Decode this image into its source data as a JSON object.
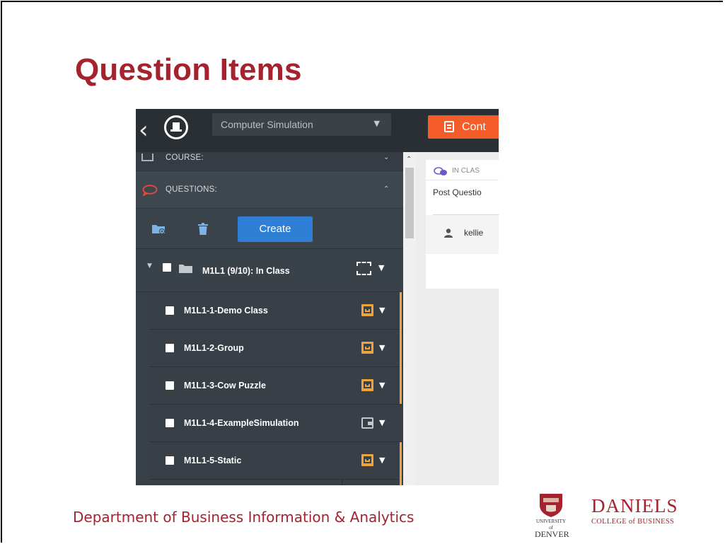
{
  "slide": {
    "title": "Question Items",
    "footer": "Department of Business Information & Analytics",
    "logo": {
      "university_line1": "UNIVERSITY of",
      "university_line2": "DENVER",
      "brand": "DANIELS",
      "brand_sub": "COLLEGE of BUSINESS"
    }
  },
  "app": {
    "course_select": {
      "value": "Computer Simulation"
    },
    "content_button": {
      "label": "Cont"
    },
    "sidebar": {
      "course_section": {
        "label": "COURSE:"
      },
      "questions_section": {
        "label": "QUESTIONS:"
      },
      "toolbar": {
        "create_label": "Create"
      },
      "folder": {
        "label": "M1L1 (9/10): In Class"
      },
      "items": [
        {
          "label": "M1L1-1-Demo Class",
          "type_icon": "slide-icon"
        },
        {
          "label": "M1L1-2-Group",
          "type_icon": "slide-icon"
        },
        {
          "label": "M1L1-3-Cow Puzzle",
          "type_icon": "slide-icon"
        },
        {
          "label": "M1L1-4-ExampleSimulation",
          "type_icon": "wallet-icon"
        },
        {
          "label": "M1L1-5-Static",
          "type_icon": "slide-icon"
        }
      ]
    },
    "right_pane": {
      "header_label": "IN CLAS",
      "post_title": "Post Questio",
      "user_name": "kellie"
    }
  },
  "colors": {
    "brand_red": "#a4232e",
    "accent_orange": "#f45c29",
    "item_orange": "#f0a23b",
    "create_blue": "#2f7fd6"
  }
}
